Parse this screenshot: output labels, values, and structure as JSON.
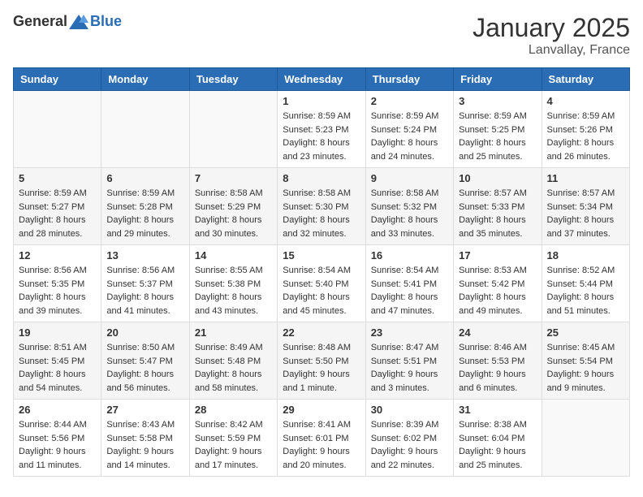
{
  "header": {
    "logo_general": "General",
    "logo_blue": "Blue",
    "month": "January 2025",
    "location": "Lanvallay, France"
  },
  "days_of_week": [
    "Sunday",
    "Monday",
    "Tuesday",
    "Wednesday",
    "Thursday",
    "Friday",
    "Saturday"
  ],
  "weeks": [
    [
      {
        "day": "",
        "info": ""
      },
      {
        "day": "",
        "info": ""
      },
      {
        "day": "",
        "info": ""
      },
      {
        "day": "1",
        "info": "Sunrise: 8:59 AM\nSunset: 5:23 PM\nDaylight: 8 hours and 23 minutes."
      },
      {
        "day": "2",
        "info": "Sunrise: 8:59 AM\nSunset: 5:24 PM\nDaylight: 8 hours and 24 minutes."
      },
      {
        "day": "3",
        "info": "Sunrise: 8:59 AM\nSunset: 5:25 PM\nDaylight: 8 hours and 25 minutes."
      },
      {
        "day": "4",
        "info": "Sunrise: 8:59 AM\nSunset: 5:26 PM\nDaylight: 8 hours and 26 minutes."
      }
    ],
    [
      {
        "day": "5",
        "info": "Sunrise: 8:59 AM\nSunset: 5:27 PM\nDaylight: 8 hours and 28 minutes."
      },
      {
        "day": "6",
        "info": "Sunrise: 8:59 AM\nSunset: 5:28 PM\nDaylight: 8 hours and 29 minutes."
      },
      {
        "day": "7",
        "info": "Sunrise: 8:58 AM\nSunset: 5:29 PM\nDaylight: 8 hours and 30 minutes."
      },
      {
        "day": "8",
        "info": "Sunrise: 8:58 AM\nSunset: 5:30 PM\nDaylight: 8 hours and 32 minutes."
      },
      {
        "day": "9",
        "info": "Sunrise: 8:58 AM\nSunset: 5:32 PM\nDaylight: 8 hours and 33 minutes."
      },
      {
        "day": "10",
        "info": "Sunrise: 8:57 AM\nSunset: 5:33 PM\nDaylight: 8 hours and 35 minutes."
      },
      {
        "day": "11",
        "info": "Sunrise: 8:57 AM\nSunset: 5:34 PM\nDaylight: 8 hours and 37 minutes."
      }
    ],
    [
      {
        "day": "12",
        "info": "Sunrise: 8:56 AM\nSunset: 5:35 PM\nDaylight: 8 hours and 39 minutes."
      },
      {
        "day": "13",
        "info": "Sunrise: 8:56 AM\nSunset: 5:37 PM\nDaylight: 8 hours and 41 minutes."
      },
      {
        "day": "14",
        "info": "Sunrise: 8:55 AM\nSunset: 5:38 PM\nDaylight: 8 hours and 43 minutes."
      },
      {
        "day": "15",
        "info": "Sunrise: 8:54 AM\nSunset: 5:40 PM\nDaylight: 8 hours and 45 minutes."
      },
      {
        "day": "16",
        "info": "Sunrise: 8:54 AM\nSunset: 5:41 PM\nDaylight: 8 hours and 47 minutes."
      },
      {
        "day": "17",
        "info": "Sunrise: 8:53 AM\nSunset: 5:42 PM\nDaylight: 8 hours and 49 minutes."
      },
      {
        "day": "18",
        "info": "Sunrise: 8:52 AM\nSunset: 5:44 PM\nDaylight: 8 hours and 51 minutes."
      }
    ],
    [
      {
        "day": "19",
        "info": "Sunrise: 8:51 AM\nSunset: 5:45 PM\nDaylight: 8 hours and 54 minutes."
      },
      {
        "day": "20",
        "info": "Sunrise: 8:50 AM\nSunset: 5:47 PM\nDaylight: 8 hours and 56 minutes."
      },
      {
        "day": "21",
        "info": "Sunrise: 8:49 AM\nSunset: 5:48 PM\nDaylight: 8 hours and 58 minutes."
      },
      {
        "day": "22",
        "info": "Sunrise: 8:48 AM\nSunset: 5:50 PM\nDaylight: 9 hours and 1 minute."
      },
      {
        "day": "23",
        "info": "Sunrise: 8:47 AM\nSunset: 5:51 PM\nDaylight: 9 hours and 3 minutes."
      },
      {
        "day": "24",
        "info": "Sunrise: 8:46 AM\nSunset: 5:53 PM\nDaylight: 9 hours and 6 minutes."
      },
      {
        "day": "25",
        "info": "Sunrise: 8:45 AM\nSunset: 5:54 PM\nDaylight: 9 hours and 9 minutes."
      }
    ],
    [
      {
        "day": "26",
        "info": "Sunrise: 8:44 AM\nSunset: 5:56 PM\nDaylight: 9 hours and 11 minutes."
      },
      {
        "day": "27",
        "info": "Sunrise: 8:43 AM\nSunset: 5:58 PM\nDaylight: 9 hours and 14 minutes."
      },
      {
        "day": "28",
        "info": "Sunrise: 8:42 AM\nSunset: 5:59 PM\nDaylight: 9 hours and 17 minutes."
      },
      {
        "day": "29",
        "info": "Sunrise: 8:41 AM\nSunset: 6:01 PM\nDaylight: 9 hours and 20 minutes."
      },
      {
        "day": "30",
        "info": "Sunrise: 8:39 AM\nSunset: 6:02 PM\nDaylight: 9 hours and 22 minutes."
      },
      {
        "day": "31",
        "info": "Sunrise: 8:38 AM\nSunset: 6:04 PM\nDaylight: 9 hours and 25 minutes."
      },
      {
        "day": "",
        "info": ""
      }
    ]
  ]
}
